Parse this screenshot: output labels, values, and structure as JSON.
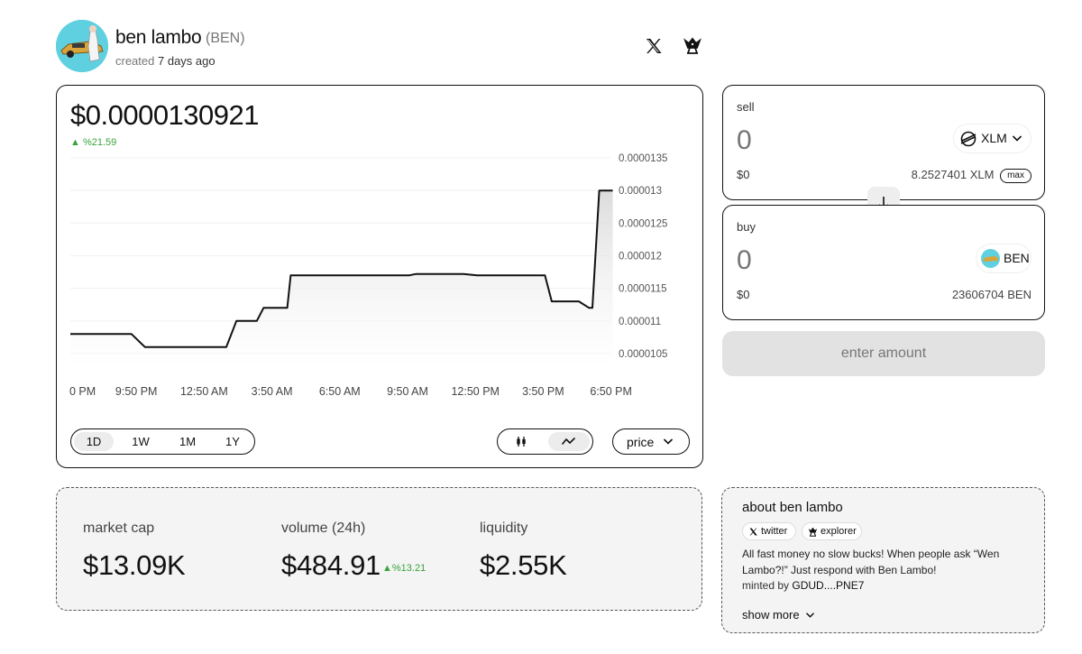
{
  "header": {
    "name": "ben lambo",
    "ticker": "(BEN)",
    "created_prefix": "created",
    "created_ago": "7 days ago"
  },
  "price": {
    "current": "$0.0000130921",
    "change": "%21.59",
    "change_color": "#3aa33a"
  },
  "chart_data": {
    "type": "line",
    "x_tick_labels": [
      "0 PM",
      "9:50 PM",
      "12:50 AM",
      "3:50 AM",
      "6:50 AM",
      "9:50 AM",
      "12:50 PM",
      "3:50 PM",
      "6:50 PM"
    ],
    "y_tick_labels": [
      "0.0000135",
      "0.000013",
      "0.0000125",
      "0.000012",
      "0.0000115",
      "0.000011",
      "0.0000105"
    ],
    "ylim": [
      1.025e-05,
      1.35e-05
    ],
    "series": [
      {
        "x": [
          0,
          0.9,
          1.1,
          1.4,
          2.3,
          2.45,
          2.75,
          2.85,
          3.2,
          3.25,
          5.0,
          5.1,
          5.8,
          6.0,
          7.0,
          7.1,
          7.5,
          7.65,
          7.7,
          7.8,
          8.0
        ],
        "values": [
          1.08e-05,
          1.08e-05,
          1.06e-05,
          1.06e-05,
          1.06e-05,
          1.1e-05,
          1.1e-05,
          1.12e-05,
          1.12e-05,
          1.17e-05,
          1.17e-05,
          1.172e-05,
          1.172e-05,
          1.17e-05,
          1.17e-05,
          1.13e-05,
          1.13e-05,
          1.12e-05,
          1.12e-05,
          1.3e-05,
          1.3e-05
        ]
      }
    ],
    "line_color": "#111111",
    "grid": true
  },
  "controls": {
    "ranges": [
      "1D",
      "1W",
      "1M",
      "1Y"
    ],
    "active_range": "1D",
    "metric": "price"
  },
  "stats": {
    "market_cap_label": "market cap",
    "market_cap": "$13.09K",
    "volume_label": "volume (24h)",
    "volume": "$484.91",
    "volume_change": "%13.21",
    "liquidity_label": "liquidity",
    "liquidity": "$2.55K"
  },
  "swap": {
    "sell_label": "sell",
    "sell_amount_placeholder": "0",
    "sell_token": "XLM",
    "sell_usd": "$0",
    "sell_balance": "8.2527401 XLM",
    "max_label": "max",
    "buy_label": "buy",
    "buy_amount_placeholder": "0",
    "buy_token": "BEN",
    "buy_usd": "$0",
    "buy_balance": "23606704 BEN",
    "action_label": "enter amount"
  },
  "about": {
    "title": "about ben lambo",
    "twitter_label": "twitter",
    "explorer_label": "explorer",
    "description": "All fast money no slow bucks! When people ask “Wen Lambo?!” Just respond with Ben Lambo!",
    "minted_prefix": "minted by",
    "minted_by": "GDUD....PNE7",
    "show_more": "show more"
  },
  "icons": {
    "x_logo": "x-logo-icon",
    "explorer": "explorer-icon",
    "chevron": "chevron-down-icon",
    "arrow_down": "arrow-down-icon",
    "candles": "candlestick-icon",
    "line": "line-chart-icon"
  }
}
